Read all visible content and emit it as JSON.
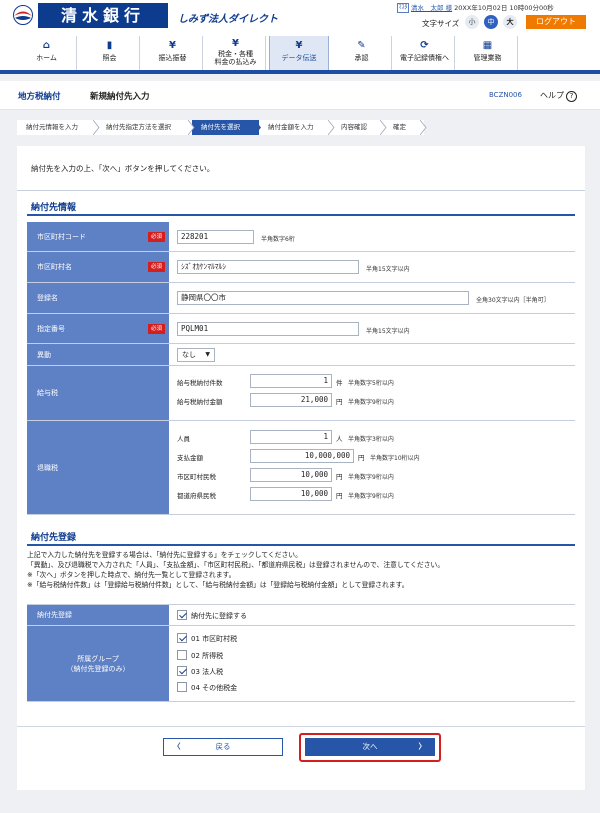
{
  "header": {
    "bank_name": "清水銀行",
    "tagline": "しみず法人ダイレクト",
    "user_icon": "ﾏｽﾀ",
    "user_name": "清水　太郎 様",
    "login_time": "20XX年10月02日 10時00分00秒",
    "font_size_label": "文字サイズ",
    "font_small": "小",
    "font_medium": "中",
    "font_large": "大",
    "logout": "ログアウト"
  },
  "nav": [
    {
      "label": "ホーム",
      "icon": "home-icon",
      "glyph": "⌂"
    },
    {
      "label": "照会",
      "icon": "document-icon",
      "glyph": "▮"
    },
    {
      "label": "振込振替",
      "icon": "yen-icon",
      "glyph": "¥"
    },
    {
      "label": "税金・各種\n料金の払込み",
      "icon": "yen-icon",
      "glyph": "¥"
    },
    {
      "label": "データ伝送",
      "icon": "yen-icon",
      "glyph": "¥"
    },
    {
      "label": "承認",
      "icon": "approve-icon",
      "glyph": "✎"
    },
    {
      "label": "電子記録債権へ",
      "icon": "sync-icon",
      "glyph": "⟳"
    },
    {
      "label": "管理業務",
      "icon": "admin-icon",
      "glyph": "▦"
    }
  ],
  "page": {
    "category": "地方税納付",
    "title": "新規納付先入力",
    "code": "BCZN006",
    "help": "ヘルプ",
    "help_icon": "?"
  },
  "steps": [
    "納付元情報を入力",
    "納付先指定方法を選択",
    "納付先を選択",
    "納付金額を入力",
    "内容確認",
    "確定"
  ],
  "intro": "納付先を入力の上、「次へ」ボタンを押してください。",
  "payee_section": {
    "title": "納付先情報",
    "required_label": "必須",
    "municipal_code": {
      "label": "市区町村コード",
      "value": "228201",
      "hint": "半角数字6桁"
    },
    "municipal_name": {
      "label": "市区町村名",
      "value": "ｼｽﾞｵｶｹﾝﾏﾙﾏﾙｼ",
      "hint": "半角15文字以内"
    },
    "registered_name": {
      "label": "登録名",
      "value": "静岡県〇〇市",
      "hint": "全角30文字以内［半角可］"
    },
    "designation_no": {
      "label": "指定番号",
      "value": "PQLM01",
      "hint": "半角15文字以内"
    },
    "transfer": {
      "label": "異動",
      "value": "なし"
    },
    "salary_tax": {
      "label": "給与税",
      "count_label": "給与税納付件数",
      "count_value": "1",
      "count_unit": "件",
      "count_hint": "半角数字5桁以内",
      "amount_label": "給与税納付金額",
      "amount_value": "21,000",
      "amount_unit": "円",
      "amount_hint": "半角数字9桁以内"
    },
    "retirement_tax": {
      "label": "退職税",
      "persons_label": "人員",
      "persons_value": "1",
      "persons_unit": "人",
      "persons_hint": "半角数字3桁以内",
      "paid_label": "支払金額",
      "paid_value": "10,000,000",
      "paid_unit": "円",
      "paid_hint": "半角数字10桁以内",
      "city_label": "市区町村民税",
      "city_value": "10,000",
      "city_unit": "円",
      "city_hint": "半角数字9桁以内",
      "pref_label": "都道府県民税",
      "pref_value": "10,000",
      "pref_unit": "円",
      "pref_hint": "半角数字9桁以内"
    }
  },
  "register_section": {
    "title": "納付先登録",
    "notes": [
      "上記で入力した納付先を登録する場合は、「納付先に登録する」をチェックしてください。",
      "「異動」、及び退職税で入力された「人員」、「支払金額」、「市区町村民税」、「都道府県民税」は登録されませんので、注意してください。",
      "※「次へ」ボタンを押した時点で、納付先一覧として登録されます。",
      "※「給与税納付件数」は「登録給与税納付件数」として、「給与税納付金額」は「登録給与税納付金額」として登録されます。"
    ],
    "register_label": "納付先登録",
    "register_checkbox": "納付先に登録する",
    "register_checked": true,
    "group_label": "所属グループ",
    "group_sublabel": "（納付先登録のみ）",
    "groups": [
      {
        "label": "01 市区町村税",
        "checked": true
      },
      {
        "label": "02 所得税",
        "checked": false
      },
      {
        "label": "03 法人税",
        "checked": true
      },
      {
        "label": "04 その他税金",
        "checked": false
      }
    ]
  },
  "buttons": {
    "back": "戻る",
    "next": "次へ",
    "back_chevron": "〈",
    "next_chevron": "〉"
  },
  "colors": {
    "brand": "#0d3b8e",
    "accent": "#2756a8",
    "label_bg": "#5e80c4",
    "required": "#d41f1f",
    "logout": "#f07a00"
  }
}
